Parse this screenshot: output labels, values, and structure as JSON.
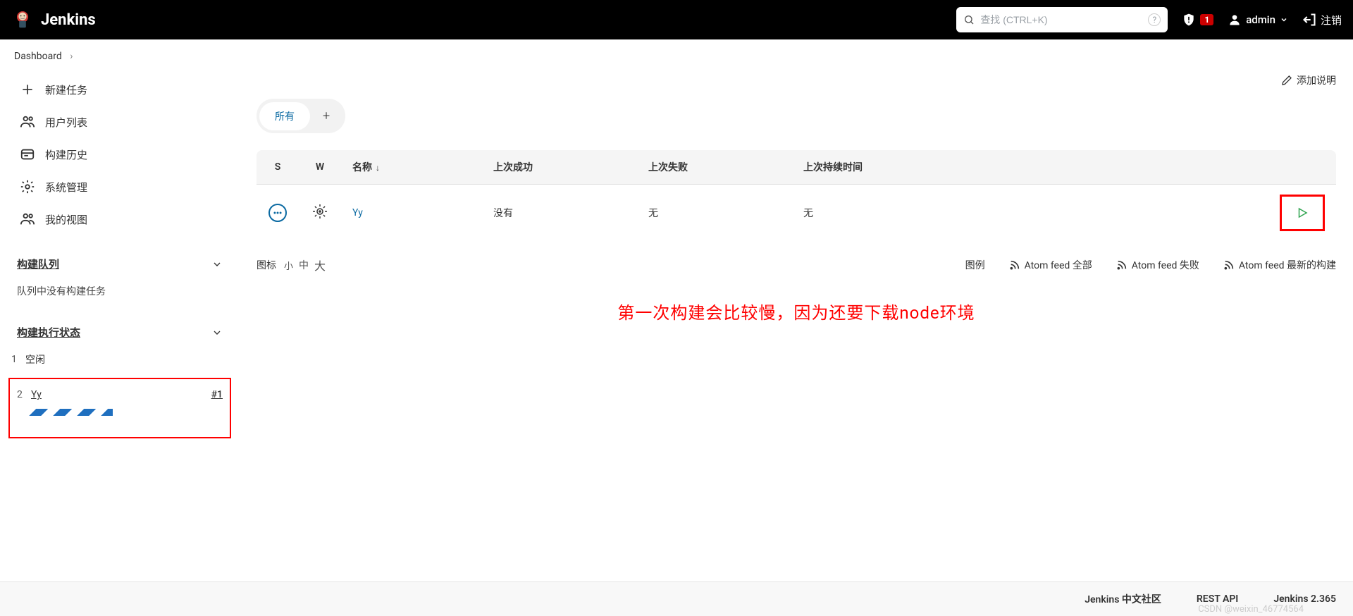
{
  "header": {
    "brand": "Jenkins",
    "search_placeholder": "查找 (CTRL+K)",
    "notification_count": "1",
    "username": "admin",
    "logout_label": "注销"
  },
  "breadcrumb": {
    "items": [
      "Dashboard"
    ]
  },
  "sidebar": {
    "menu": [
      {
        "label": "新建任务"
      },
      {
        "label": "用户列表"
      },
      {
        "label": "构建历史"
      },
      {
        "label": "系统管理"
      },
      {
        "label": "我的视图"
      }
    ],
    "queue_panel": {
      "title": "构建队列",
      "empty_text": "队列中没有构建任务"
    },
    "executor_panel": {
      "title": "构建执行状态",
      "executors": [
        {
          "num": "1",
          "text": "空闲"
        },
        {
          "num": "2",
          "name": "Yy",
          "build": "#1"
        }
      ]
    }
  },
  "main": {
    "add_description": "添加说明",
    "tabs": {
      "all": "所有"
    },
    "table": {
      "columns": {
        "status": "S",
        "weather": "W",
        "name": "名称",
        "last_success": "上次成功",
        "last_failure": "上次失败",
        "last_duration": "上次持续时间"
      },
      "rows": [
        {
          "name": "Yy",
          "last_success": "没有",
          "last_failure": "无",
          "last_duration": "无"
        }
      ]
    },
    "footer": {
      "icon_label": "图标",
      "size_s": "小",
      "size_m": "中",
      "size_l": "大",
      "legend": "图例",
      "feed_all": "Atom feed 全部",
      "feed_fail": "Atom feed 失败",
      "feed_latest": "Atom feed 最新的构建"
    },
    "annotation": "第一次构建会比较慢，因为还要下载node环境"
  },
  "page_footer": {
    "community": "Jenkins 中文社区",
    "rest_api": "REST API",
    "version": "Jenkins 2.365"
  },
  "watermark": "CSDN @weixin_46774564"
}
